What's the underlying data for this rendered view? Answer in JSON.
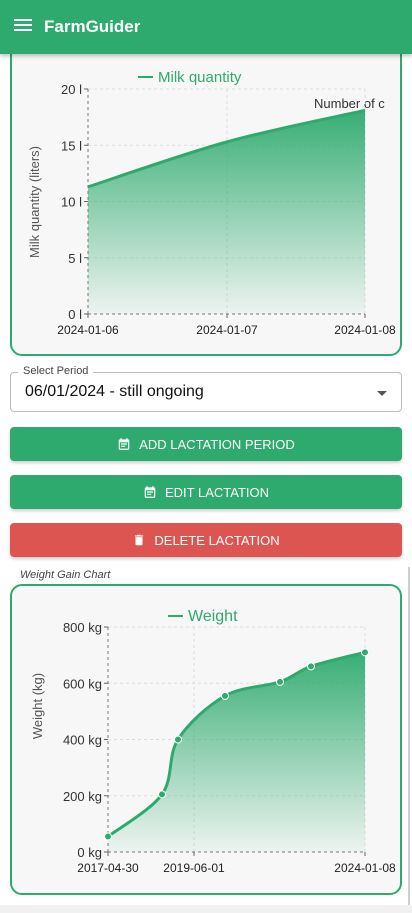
{
  "app": {
    "title": "FarmGuider",
    "menu_icon": "menu-icon"
  },
  "colors": {
    "primary": "#2eaa6e",
    "danger": "#dc5550",
    "area_top": "#2eaa6e"
  },
  "milk_chart": {
    "legend": "Milk quantity",
    "ylabel": "Milk quantity (liters)",
    "annotation": "Number of c",
    "y_ticks": [
      "20 l",
      "15 l",
      "10 l",
      "5 l",
      "0 l"
    ],
    "x_ticks": [
      "2024-01-06",
      "2024-01-07",
      "2024-01-08"
    ]
  },
  "select": {
    "label": "Select Period",
    "value": "06/01/2024 - still ongoing"
  },
  "buttons": {
    "add": {
      "label": "ADD LACTATION PERIOD",
      "icon": "calendar-icon"
    },
    "edit": {
      "label": "EDIT LACTATION",
      "icon": "calendar-icon"
    },
    "delete": {
      "label": "DELETE LACTATION",
      "icon": "trash-icon"
    }
  },
  "weight_section": {
    "caption": "Weight Gain Chart"
  },
  "weight_chart": {
    "legend": "Weight",
    "ylabel": "Weight (kg)",
    "y_ticks": [
      "800 kg",
      "600 kg",
      "400 kg",
      "200 kg",
      "0 kg"
    ],
    "x_ticks": [
      "2017-04-30",
      "2019-06-01",
      "2024-01-08"
    ]
  },
  "chart_data": [
    {
      "type": "area",
      "title": "",
      "xlabel": "",
      "ylabel": "Milk quantity (liters)",
      "x": [
        "2024-01-06",
        "2024-01-07",
        "2024-01-08"
      ],
      "series": [
        {
          "name": "Milk quantity",
          "values": [
            11.3,
            15.3,
            18.1
          ]
        }
      ],
      "ylim": [
        0,
        20
      ],
      "grid": true,
      "legend": "top-center"
    },
    {
      "type": "area",
      "title": "",
      "xlabel": "",
      "ylabel": "Weight (kg)",
      "x": [
        "2017-04-30",
        "2018-10-01",
        "2018-11-15",
        "2019-06-01",
        "2021-06-01",
        "2022-03-01",
        "2024-01-08"
      ],
      "series": [
        {
          "name": "Weight",
          "values": [
            55,
            205,
            400,
            555,
            605,
            660,
            710
          ]
        }
      ],
      "ylim": [
        0,
        800
      ],
      "grid": true,
      "legend": "top-center"
    }
  ]
}
